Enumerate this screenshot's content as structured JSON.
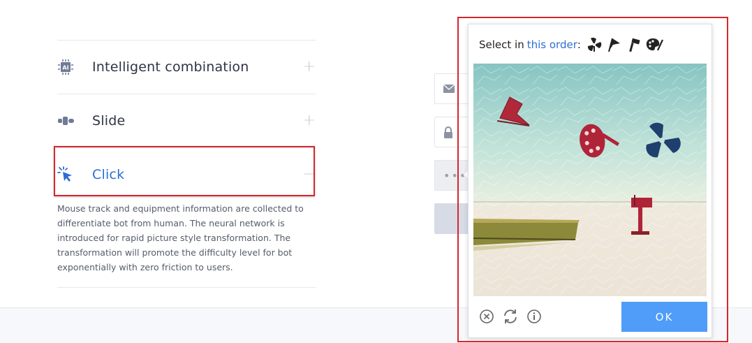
{
  "accordion": {
    "items": [
      {
        "label": "Intelligent combination",
        "icon": "ai-chip-icon",
        "toggle": "+",
        "active": false
      },
      {
        "label": "Slide",
        "icon": "slider-icon",
        "toggle": "+",
        "active": false
      },
      {
        "label": "Click",
        "icon": "click-cursor-icon",
        "toggle": "−",
        "active": true,
        "description": "Mouse track and equipment information are collected to differentiate bot from human. The neural network is introduced for rapid picture style transformation. The transformation will promote the difficulty level for bot exponentially with zero friction to users."
      }
    ]
  },
  "captcha": {
    "prompt_prefix": "Select in",
    "prompt_order": "this order",
    "prompt_colon": ":",
    "sequence_icons": [
      "fan-icon",
      "flag-icon",
      "hammer-icon",
      "palette-icon"
    ],
    "image_icons": [
      "flag-icon",
      "palette-icon",
      "fan-icon",
      "mailbox-icon",
      "boat-icon"
    ],
    "toolbar": [
      "close-icon",
      "refresh-icon",
      "info-icon"
    ],
    "ok_label": "OK"
  },
  "background_form": {
    "field_icons": [
      "mail-icon",
      "lock-icon"
    ],
    "dots": "•••"
  },
  "colors": {
    "accent": "#2f6dd4",
    "ok_button": "#4f9cf9",
    "highlight": "#d6262c"
  }
}
